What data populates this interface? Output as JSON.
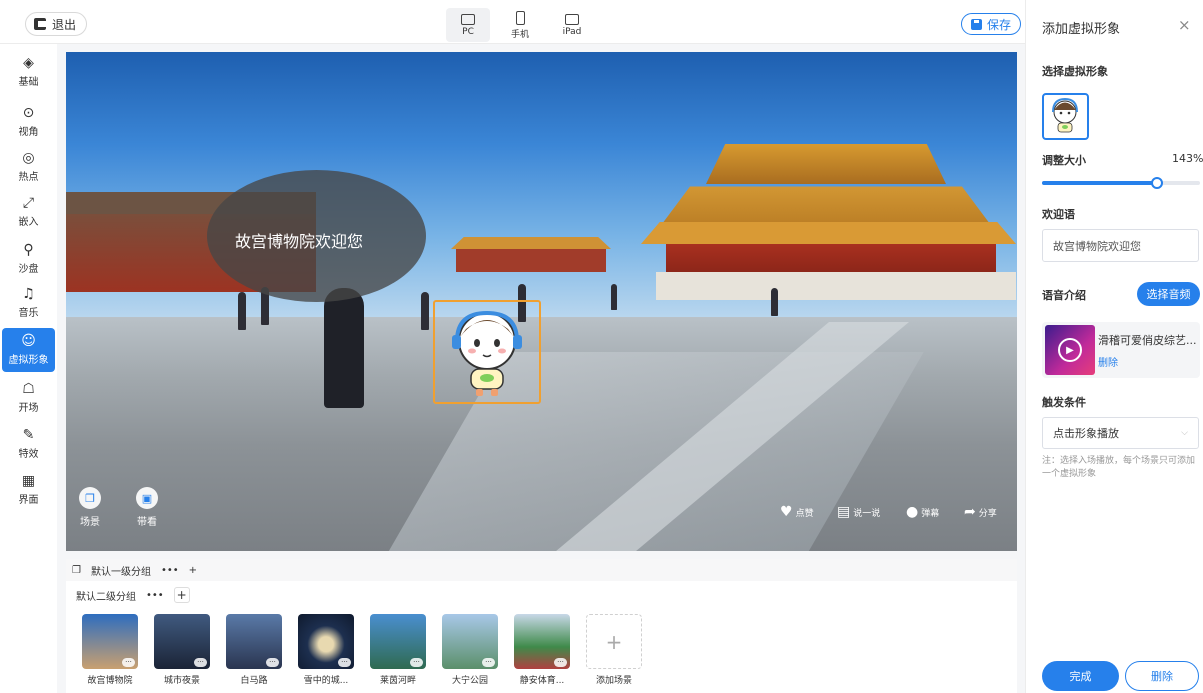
{
  "topbar": {
    "exit_label": "退出",
    "devices": [
      {
        "label": "PC",
        "icon": "monitor-icon",
        "active": true
      },
      {
        "label": "手机",
        "icon": "phone-icon",
        "active": false
      },
      {
        "label": "iPad",
        "icon": "tablet-icon",
        "active": false
      }
    ],
    "save_label": "保存"
  },
  "sidebar": {
    "items": [
      {
        "label": "基础",
        "icon": "layers-icon"
      },
      {
        "label": "视角",
        "icon": "view-angle-icon"
      },
      {
        "label": "热点",
        "icon": "hotspot-icon"
      },
      {
        "label": "嵌入",
        "icon": "embed-icon"
      },
      {
        "label": "沙盘",
        "icon": "sandbox-icon"
      },
      {
        "label": "音乐",
        "icon": "music-icon"
      },
      {
        "label": "虚拟形象",
        "icon": "avatar-icon",
        "active": true
      },
      {
        "label": "开场",
        "icon": "opening-icon"
      },
      {
        "label": "特效",
        "icon": "effects-icon"
      },
      {
        "label": "界面",
        "icon": "interface-icon"
      }
    ]
  },
  "viewer": {
    "speech_text": "故宫博物院欢迎您",
    "left_buttons": [
      {
        "label": "场景",
        "icon": "scene-icon"
      },
      {
        "label": "带看",
        "icon": "guide-icon"
      }
    ],
    "actions": [
      {
        "label": "点赞",
        "icon": "heart-icon"
      },
      {
        "label": "说一说",
        "icon": "comment-icon"
      },
      {
        "label": "弹幕",
        "icon": "danmaku-icon"
      },
      {
        "label": "分享",
        "icon": "share-icon"
      }
    ]
  },
  "scenes": {
    "group1_label": "默认一级分组",
    "group2_label": "默认二级分组",
    "more": "•••",
    "plus": "+",
    "items": [
      {
        "name": "故宫博物院",
        "color": "#3c6fb0"
      },
      {
        "name": "城市夜景",
        "color": "#2c3e5c"
      },
      {
        "name": "白马路",
        "color": "#3a4a6a"
      },
      {
        "name": "雪中的城...",
        "color": "#1d2f4f"
      },
      {
        "name": "莱茵河畔",
        "color": "#2f6fa8"
      },
      {
        "name": "大宁公园",
        "color": "#5b8f6a"
      },
      {
        "name": "静安体育...",
        "color": "#8aa77a"
      }
    ],
    "add_label": "添加场景"
  },
  "panel": {
    "title": "添加虚拟形象",
    "close": "×",
    "choose_avatar_label": "选择虚拟形象",
    "size_label": "调整大小",
    "size_value": "143%",
    "size_fraction": 0.73,
    "greeting_label": "欢迎语",
    "greeting_value": "故宫博物院欢迎您",
    "voice_label": "语音介绍",
    "choose_audio": "选择音频",
    "audio_name": "滑稽可爱俏皮综艺...",
    "audio_delete": "删除",
    "trigger_label": "触发条件",
    "trigger_value": "点击形象播放",
    "note": "注：选择入场播放，每个场景只可添加一个虚拟形象",
    "done": "完成",
    "delete": "删除"
  },
  "colors": {
    "accent": "#2680eb",
    "avatar_frame": "#f0a030"
  }
}
